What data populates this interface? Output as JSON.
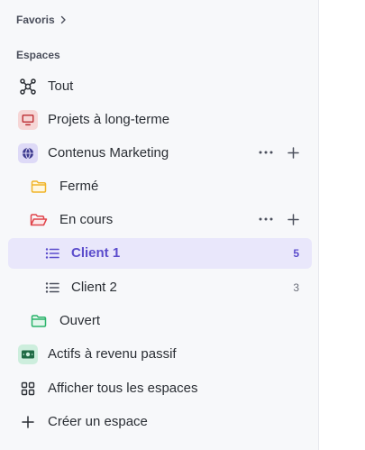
{
  "sidebar": {
    "favorites_label": "Favoris",
    "spaces_label": "Espaces",
    "items": [
      {
        "label": "Tout",
        "icon": "hierarchy-icon"
      },
      {
        "label": "Projets à long-terme",
        "icon": "monitor-icon",
        "color": "#d85a5a"
      },
      {
        "label": "Contenus Marketing",
        "icon": "globe-icon",
        "color": "#6a5bd6"
      },
      {
        "label": "Fermé",
        "icon": "folder-icon",
        "color": "#f0b429"
      },
      {
        "label": "En cours",
        "icon": "folder-open-icon",
        "color": "#e0444b"
      },
      {
        "label": "Client 1",
        "icon": "list-icon",
        "count": "5"
      },
      {
        "label": "Client 2",
        "icon": "list-icon",
        "count": "3"
      },
      {
        "label": "Ouvert",
        "icon": "folder-icon",
        "color": "#2bb36b"
      },
      {
        "label": "Actifs à revenu passif",
        "icon": "money-icon",
        "color": "#2bb36b"
      },
      {
        "label": "Afficher tous les espaces",
        "icon": "grid-icon"
      },
      {
        "label": "Créer un espace",
        "icon": "plus-icon"
      }
    ]
  }
}
